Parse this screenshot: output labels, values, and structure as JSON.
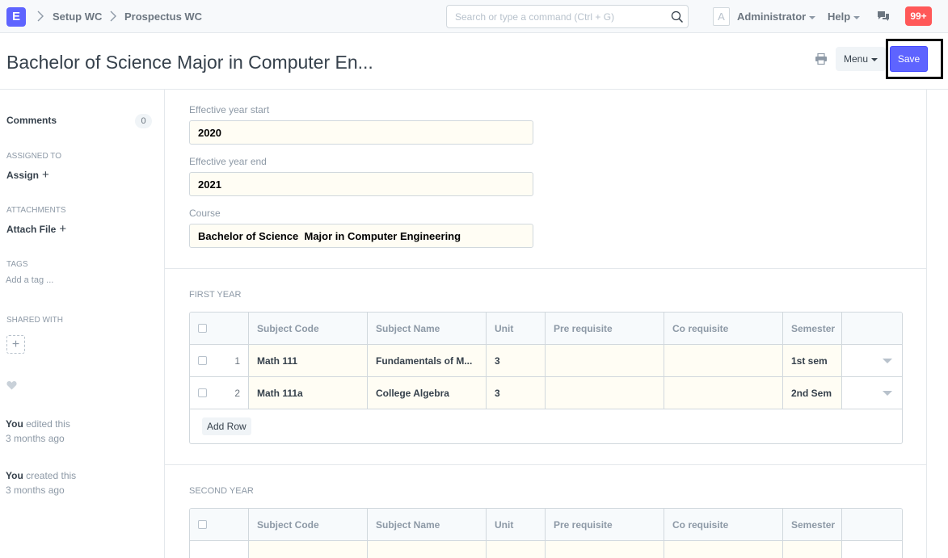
{
  "navbar": {
    "logo": "E",
    "breadcrumbs": [
      "Setup WC",
      "Prospectus WC"
    ],
    "search_placeholder": "Search or type a command (Ctrl + G)",
    "avatar_letter": "A",
    "user": "Administrator",
    "help": "Help",
    "notifications": "99+"
  },
  "page": {
    "title": "Bachelor of Science Major in Computer En...",
    "menu_label": "Menu",
    "save_label": "Save"
  },
  "sidebar": {
    "comments_label": "Comments",
    "comments_count": "0",
    "assigned_to_label": "ASSIGNED TO",
    "assign_label": "Assign",
    "attachments_label": "ATTACHMENTS",
    "attach_label": "Attach File",
    "tags_label": "TAGS",
    "add_tag_label": "Add a tag ...",
    "shared_with_label": "SHARED WITH",
    "timeline": [
      {
        "who": "You",
        "action": "edited this",
        "when": "3 months ago"
      },
      {
        "who": "You",
        "action": "created this",
        "when": "3 months ago"
      }
    ]
  },
  "form": {
    "fields": [
      {
        "label": "Effective year start",
        "value": "2020"
      },
      {
        "label": "Effective year end",
        "value": "2021"
      },
      {
        "label": "Course",
        "value": "Bachelor of Science  Major in Computer Engineering"
      }
    ],
    "columns": [
      "Subject Code",
      "Subject Name",
      "Unit",
      "Pre requisite",
      "Co requisite",
      "Semester"
    ],
    "add_row_label": "Add Row",
    "sections": [
      {
        "title": "FIRST YEAR",
        "rows": [
          {
            "no": "1",
            "code": "Math 111",
            "name": "Fundamentals of M...",
            "unit": "3",
            "pre": "",
            "co": "",
            "semester": "1st sem"
          },
          {
            "no": "2",
            "code": "Math 111a",
            "name": "College Algebra",
            "unit": "3",
            "pre": "",
            "co": "",
            "semester": "2nd Sem"
          }
        ]
      },
      {
        "title": "SECOND YEAR",
        "rows": []
      }
    ]
  },
  "colors": {
    "primary": "#5e64ff",
    "notification": "#ff5858",
    "input_bg": "#fffdf4"
  }
}
